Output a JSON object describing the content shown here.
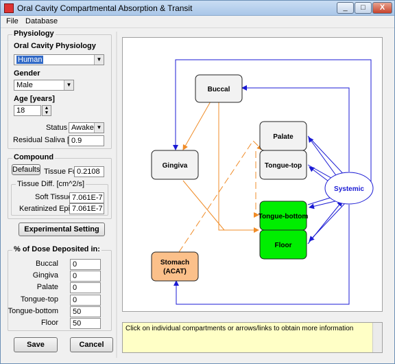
{
  "window": {
    "title": "Oral Cavity Compartmental Absorption & Transit",
    "minimize": "_",
    "maximize": "□",
    "close": "X"
  },
  "menu": {
    "items": [
      "File",
      "Database"
    ]
  },
  "physiology": {
    "group_title": "Physiology",
    "oral_cavity_label": "Oral Cavity Physiology",
    "oral_cavity_value": "Human",
    "gender_label": "Gender",
    "gender_value": "Male",
    "age_label": "Age [years]",
    "age_value": "18",
    "status_label": "Status",
    "status_value": "Awake",
    "residual_label": "Residual Saliva [mL]",
    "residual_value": "0.9"
  },
  "compound": {
    "group_title": "Compound",
    "defaults_label": "Defaults",
    "tissue_fut_label": "Tissue Fut",
    "tissue_fut_value": "0.2108",
    "tissue_diff_title": "Tissue Diff. [cm^2/s]",
    "soft_label": "Soft Tissues",
    "soft_value": "7.061E-7",
    "kerat_label": "Keratinized Epithel",
    "kerat_value": "7.061E-7"
  },
  "experimental_button": "Experimental Setting",
  "dose": {
    "group_title": "% of Dose Deposited in:",
    "rows": [
      {
        "label": "Buccal",
        "value": "0"
      },
      {
        "label": "Gingiva",
        "value": "0"
      },
      {
        "label": "Palate",
        "value": "0"
      },
      {
        "label": "Tongue-top",
        "value": "0"
      },
      {
        "label": "Tongue-bottom",
        "value": "50"
      },
      {
        "label": "Floor",
        "value": "50"
      }
    ]
  },
  "buttons": {
    "save": "Save",
    "cancel": "Cancel"
  },
  "diagram": {
    "nodes": {
      "buccal": "Buccal",
      "gingiva": "Gingiva",
      "palate": "Palate",
      "tongue_top": "Tongue-top",
      "tongue_bottom": "Tongue-bottom",
      "floor": "Floor",
      "stomach_line1": "Stomach",
      "stomach_line2": "(ACAT)",
      "systemic": "Systemic"
    },
    "colors": {
      "default": "#f2f2f2",
      "active": "#00ee00",
      "stomach": "#fbc08a",
      "blue_link": "#1a1ad4",
      "orange_link": "#f08c28"
    }
  },
  "info_text": "Click on individual compartments or arrows/links to obtain more information"
}
